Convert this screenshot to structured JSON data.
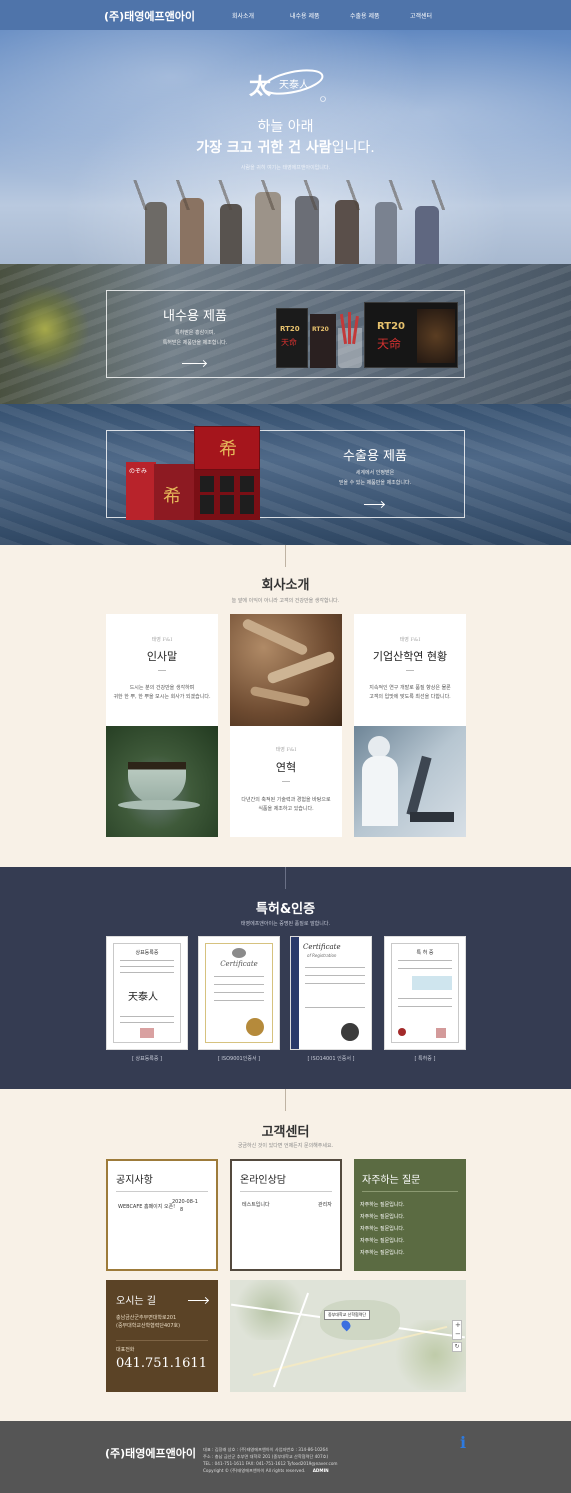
{
  "header": {
    "logo": "(주)태영에프앤아이",
    "nav": [
      "회사소개",
      "내수용 제품",
      "수출용 제품",
      "고객센터"
    ]
  },
  "hero": {
    "brand_text": "天泰人",
    "line1": "하늘 아래",
    "line2_bold": "가장 크고 귀한 건 사람",
    "line2_rest": "입니다.",
    "sub": "사람을 귀히 여기는 태영에프앤아이입니다."
  },
  "domestic": {
    "title": "내수용 제품",
    "desc1": "특허받은 홍삼이며,",
    "desc2": "특허받은 제품만을 제조합니다.",
    "box_label": "RT20",
    "box_label2": "天命"
  },
  "export": {
    "title": "수출용 제품",
    "desc1": "세계에서 인정받은",
    "desc2": "믿을 수 있는 제품만을 제조합니다.",
    "box_char": "希",
    "box_char2": "のぞみ"
  },
  "company": {
    "title": "회사소개",
    "sub": "늘 앞에 이익이 아니라 고객의 건강만을 생각합니다.",
    "cards": [
      {
        "small": "태영 F&I",
        "head": "인사말",
        "l1": "드시는 분의 건강만을 생각하며",
        "l2": "귀한 한 뿌, 한 뿌을 모시는 회사가 되겠습니다."
      },
      {
        "small": "태영 F&I",
        "head": "연혁",
        "l1": "다년간의 축적된 기술력과 경험을 바탕으로",
        "l2": "식품을 제조하고 있습니다."
      },
      {
        "small": "태영 F&I",
        "head": "기업산학연 현황",
        "l1": "지속적인 연구 개발로 품질 향상은 물론",
        "l2": "고객의 입맛에 맞도록 최선을 다합니다."
      }
    ]
  },
  "cert": {
    "title": "특허&인증",
    "sub": "태영에프앤아이는 증명된 품질로 말합니다.",
    "items": [
      {
        "caption": "[ 상표등록증 ]",
        "doc_title": "상표등록증",
        "mark": "天泰人"
      },
      {
        "caption": "[ ISO9001인증서 ]",
        "doc_title": "Certificate"
      },
      {
        "caption": "[ ISO14001 인증서 ]",
        "doc_title": "Certificate",
        "doc_sub": "of Registration"
      },
      {
        "caption": "[ 특허증 ]",
        "doc_title": "특 허 증"
      }
    ]
  },
  "customer": {
    "title": "고객센터",
    "sub": "궁금하신 것이 있다면 언제든지 문의해주세요.",
    "notice": {
      "title": "공지사항",
      "item": "WEBCAFE 홈페이지 오픈!",
      "date": "2020-08-1",
      "date2": "8"
    },
    "consult": {
      "title": "온라인상담",
      "item": "테스트입니다",
      "author": "관리자"
    },
    "faq": {
      "title": "자주하는 질문",
      "items": [
        "자주하는 질문입니다.",
        "자주하는 질문입니다.",
        "자주하는 질문입니다.",
        "자주하는 질문입니다.",
        "자주하는 질문입니다."
      ]
    },
    "location": {
      "title": "오시는 길",
      "addr1": "충남금산군추부면대학로201",
      "addr2": "(중부대학교산학협력단407호)",
      "phone_label": "대표전화",
      "phone": "041.751.1611"
    },
    "map": {
      "marker": "중부대학교 산학협력단",
      "zoom_in": "+",
      "zoom_out": "−",
      "refresh": "↻"
    }
  },
  "footer": {
    "logo": "(주)태영에프앤아이",
    "line1": "대표 : 김장래      상호 : (주)태영에프앤아이      사업자번호 : 314-86-10264",
    "line2": "주소 : 충남 금산군 추부면 대학로 201 (중부대학교 산학협력단 407호)",
    "line3": "TEL : 041-751-1611      FAX: 041-751-1612      Tyfood2019@naver.com",
    "copyright": "Copyright © (주)태영에프앤아이 All rights reserved.",
    "admin": "ADMIN",
    "info_icon": "i"
  },
  "colors": {
    "header": "#4f74aa",
    "cert_bg": "#353c52",
    "notice_border": "#9d7b3a",
    "faq_bg": "#5b6b42",
    "location_bg": "#5b4326",
    "footer_bg": "#555555"
  }
}
